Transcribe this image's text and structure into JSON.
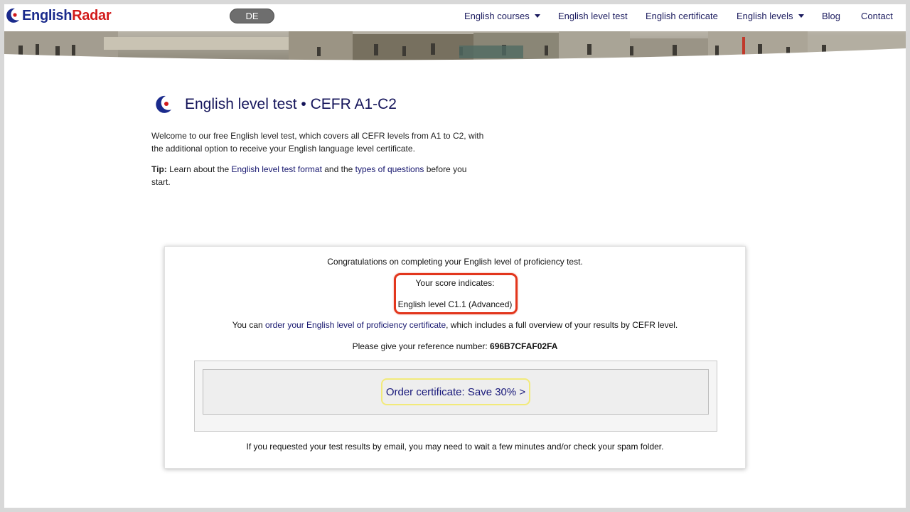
{
  "header": {
    "logo_english": "English",
    "logo_radar": "Radar",
    "lang_button": "DE",
    "nav": [
      {
        "label": "English courses",
        "dropdown": true
      },
      {
        "label": "English level test",
        "dropdown": false
      },
      {
        "label": "English certificate",
        "dropdown": false
      },
      {
        "label": "English levels",
        "dropdown": true
      },
      {
        "label": "Blog",
        "dropdown": false
      },
      {
        "label": "Contact",
        "dropdown": false
      }
    ]
  },
  "main": {
    "title": "English level test • CEFR A1-C2",
    "intro_text": "Welcome to our free English level test, which covers all CEFR levels from A1 to C2, with the additional option to receive your English language level certificate.",
    "tip_label": "Tip:",
    "tip_part1": " Learn about the ",
    "tip_link1": "English level test format",
    "tip_part2": " and the ",
    "tip_link2": "types of questions",
    "tip_part3": " before you start."
  },
  "result": {
    "congrats": "Congratulations on completing your English level of proficiency test.",
    "score_label": "Your score indicates:",
    "score_value": "English level C1.1 (Advanced)",
    "order_prefix": "You can ",
    "order_link": "order your English level of proficiency certificate",
    "order_suffix": ", which includes a full overview of your results by CEFR level.",
    "ref_prefix": "Please give your reference number: ",
    "ref_number": "696B7CFAF02FA",
    "order_button": "Order certificate: Save 30% >",
    "email_note": "If you requested your test results by email, you may need to wait a few minutes and/or check your spam folder."
  },
  "colors": {
    "brand_blue": "#1a2a8c",
    "brand_red": "#d21a1a",
    "highlight_red": "#e2361d",
    "highlight_yellow": "#f2ea7a",
    "link": "#16166e"
  }
}
